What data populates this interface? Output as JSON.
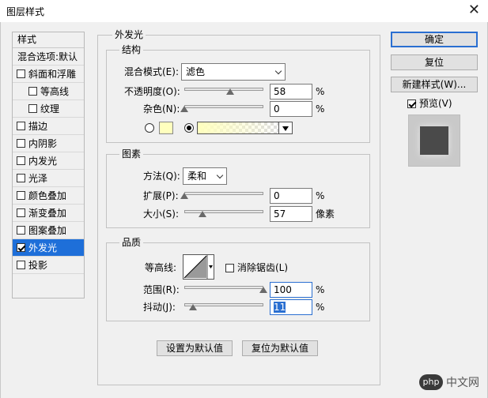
{
  "window": {
    "title": "图层样式",
    "close_glyph": "✕"
  },
  "styles_list": {
    "header": "样式",
    "blend_options": "混合选项:默认",
    "items": [
      {
        "label": "斜面和浮雕",
        "checked": false,
        "sub": false
      },
      {
        "label": "等高线",
        "checked": false,
        "sub": true
      },
      {
        "label": "纹理",
        "checked": false,
        "sub": true
      },
      {
        "label": "描边",
        "checked": false,
        "sub": false
      },
      {
        "label": "内阴影",
        "checked": false,
        "sub": false
      },
      {
        "label": "内发光",
        "checked": false,
        "sub": false
      },
      {
        "label": "光泽",
        "checked": false,
        "sub": false
      },
      {
        "label": "颜色叠加",
        "checked": false,
        "sub": false
      },
      {
        "label": "渐变叠加",
        "checked": false,
        "sub": false
      },
      {
        "label": "图案叠加",
        "checked": false,
        "sub": false
      },
      {
        "label": "外发光",
        "checked": true,
        "sub": false,
        "selected": true
      },
      {
        "label": "投影",
        "checked": false,
        "sub": false
      }
    ]
  },
  "outer_glow": {
    "title": "外发光",
    "structure": {
      "title": "结构",
      "blend_mode_label": "混合模式(E):",
      "blend_mode_value": "滤色",
      "opacity_label": "不透明度(O):",
      "opacity_value": "58",
      "opacity_fraction": 0.58,
      "noise_label": "杂色(N):",
      "noise_value": "0",
      "noise_fraction": 0.0,
      "percent": "%",
      "glow_color": "#ffffbe"
    },
    "elements": {
      "title": "图素",
      "method_label": "方法(Q):",
      "method_value": "柔和",
      "spread_label": "扩展(P):",
      "spread_value": "0",
      "spread_fraction": 0.0,
      "size_label": "大小(S):",
      "size_value": "57",
      "size_fraction": 0.23,
      "size_unit": "像素",
      "percent": "%"
    },
    "quality": {
      "title": "品质",
      "contour_label": "等高线:",
      "antialias_label": "消除锯齿(L)",
      "antialias_checked": false,
      "range_label": "范围(R):",
      "range_value": "100",
      "range_fraction": 1.0,
      "jitter_label": "抖动(J):",
      "jitter_value": "11",
      "jitter_fraction": 0.11,
      "percent": "%"
    },
    "make_default": "设置为默认值",
    "reset_default": "复位为默认值"
  },
  "buttons": {
    "ok": "确定",
    "reset": "复位",
    "new_style": "新建样式(W)...",
    "preview_label": "预览(V)",
    "preview_checked": true
  },
  "watermark": {
    "logo": "php",
    "text": "中文网"
  }
}
